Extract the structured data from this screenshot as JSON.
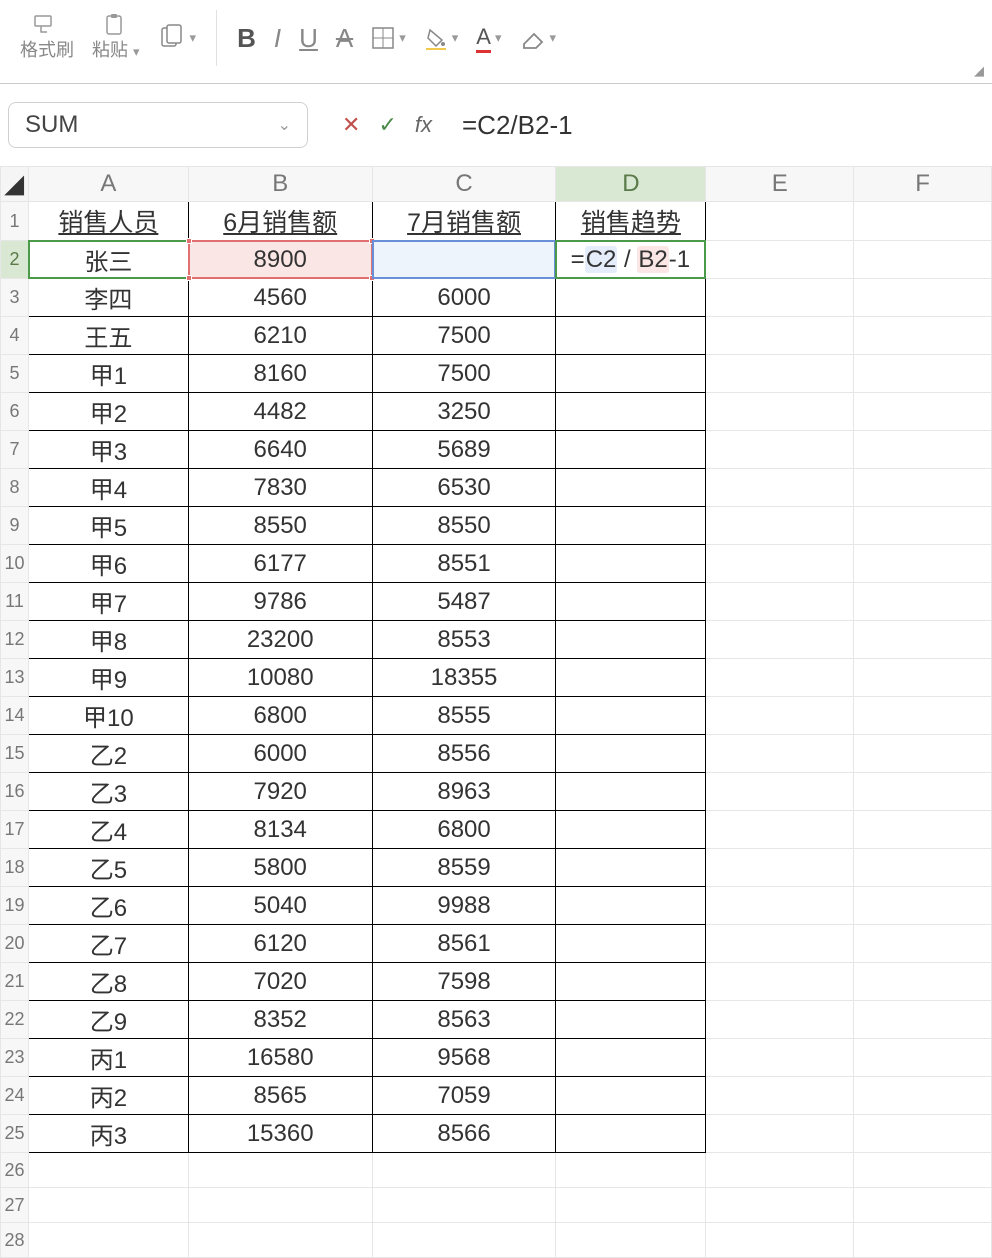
{
  "ribbon": {
    "format_painter": "格式刷",
    "paste": "粘贴"
  },
  "namebox": {
    "value": "SUM"
  },
  "formula_bar": {
    "fx": "fx",
    "value": "=C2/B2-1"
  },
  "columns": [
    "A",
    "B",
    "C",
    "D",
    "E",
    "F"
  ],
  "row_numbers": [
    1,
    2,
    3,
    4,
    5,
    6,
    7,
    8,
    9,
    10,
    11,
    12,
    13,
    14,
    15,
    16,
    17,
    18,
    19,
    20,
    21,
    22,
    23,
    24,
    25,
    26,
    27,
    28
  ],
  "header_row": {
    "A": "销售人员",
    "B": "6月销售额",
    "C": "7月销售额",
    "D": "销售趋势"
  },
  "active_cell_formula": {
    "prefix": "=",
    "c2": "C2",
    "div": " / ",
    "b2": "B2",
    "suffix": "-1"
  },
  "rows": [
    {
      "A": "张三",
      "B": "8900",
      "C": "",
      "D_formula": true
    },
    {
      "A": "李四",
      "B": "4560",
      "C": "6000"
    },
    {
      "A": "王五",
      "B": "6210",
      "C": "7500"
    },
    {
      "A": "甲1",
      "B": "8160",
      "C": "7500"
    },
    {
      "A": "甲2",
      "B": "4482",
      "C": "3250"
    },
    {
      "A": "甲3",
      "B": "6640",
      "C": "5689"
    },
    {
      "A": "甲4",
      "B": "7830",
      "C": "6530"
    },
    {
      "A": "甲5",
      "B": "8550",
      "C": "8550"
    },
    {
      "A": "甲6",
      "B": "6177",
      "C": "8551"
    },
    {
      "A": "甲7",
      "B": "9786",
      "C": "5487"
    },
    {
      "A": "甲8",
      "B": "23200",
      "C": "8553"
    },
    {
      "A": "甲9",
      "B": "10080",
      "C": "18355"
    },
    {
      "A": "甲10",
      "B": "6800",
      "C": "8555"
    },
    {
      "A": "乙2",
      "B": "6000",
      "C": "8556"
    },
    {
      "A": "乙3",
      "B": "7920",
      "C": "8963"
    },
    {
      "A": "乙4",
      "B": "8134",
      "C": "6800"
    },
    {
      "A": "乙5",
      "B": "5800",
      "C": "8559"
    },
    {
      "A": "乙6",
      "B": "5040",
      "C": "9988"
    },
    {
      "A": "乙7",
      "B": "6120",
      "C": "8561"
    },
    {
      "A": "乙8",
      "B": "7020",
      "C": "7598"
    },
    {
      "A": "乙9",
      "B": "8352",
      "C": "8563"
    },
    {
      "A": "丙1",
      "B": "16580",
      "C": "9568"
    },
    {
      "A": "丙2",
      "B": "8565",
      "C": "7059"
    },
    {
      "A": "丙3",
      "B": "15360",
      "C": "8566"
    }
  ]
}
